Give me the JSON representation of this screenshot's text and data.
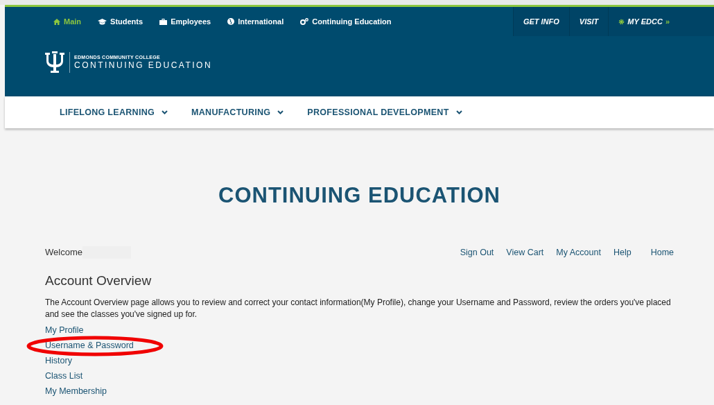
{
  "top_nav": [
    {
      "label": "Main",
      "selected": true
    },
    {
      "label": "Students",
      "selected": false
    },
    {
      "label": "Employees",
      "selected": false
    },
    {
      "label": "International",
      "selected": false
    },
    {
      "label": "Continuing Education",
      "selected": false
    }
  ],
  "utility_nav": [
    {
      "label": "GET INFO"
    },
    {
      "label": "VISIT"
    },
    {
      "label": "MY EDCC",
      "suffix": "»"
    }
  ],
  "logo": {
    "college": "EDMONDS COMMUNITY COLLEGE",
    "name": "CONTINUING EDUCATION"
  },
  "main_menu": [
    "LIFELONG LEARNING",
    "MANUFACTURING",
    "PROFESSIONAL DEVELOPMENT"
  ],
  "page_title": "CONTINUING EDUCATION",
  "welcome": "Welcome",
  "account_links": [
    "Sign Out",
    "View Cart",
    "My Account",
    "Help",
    "Home"
  ],
  "section_title": "Account Overview",
  "description": "The Account Overview page allows you to review and correct your contact information(My Profile), change your Username and Password, review the orders you've placed and see the classes you've signed up for.",
  "links": [
    {
      "label": "My Profile",
      "highlighted": false
    },
    {
      "label": "Username & Password",
      "highlighted": true
    },
    {
      "label": "History",
      "highlighted": false
    },
    {
      "label": "Class List",
      "highlighted": false
    },
    {
      "label": "My Membership",
      "highlighted": false
    }
  ]
}
